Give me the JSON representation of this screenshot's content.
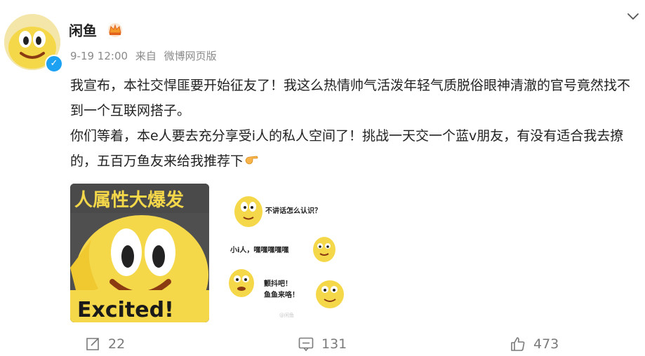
{
  "user": {
    "name": "闲鱼",
    "time": "9-19 12:00",
    "source_prefix": "来自",
    "source": "微博网页版",
    "badge_icon": "crown-icon",
    "verified_icon": "verified-badge-icon"
  },
  "post": {
    "paragraph1": "我宣布，本社交悍匪要开始征友了！我这么热情帅气活泼年轻气质脱俗眼神清澈的官号竟然找不到一个互联网搭子。",
    "paragraph2": "你们等着，本e人要去充分享受i人的私人空间了！挑战一天交一个蓝v朋友，有没有适合我去撩的，五百万鱼友来给我推荐下",
    "emoji": "pointing-hand-emoji"
  },
  "images": {
    "img1": {
      "top_text": "人属性大爆发",
      "bottom_text": "Excited!"
    },
    "img2": {
      "q1": "不讲话怎么认识？",
      "q2": "小i人，嘿嘿嘿嘿嘿",
      "q3a": "颤抖吧！",
      "q3b": "鱼鱼来咯！",
      "watermark": "@闲鱼"
    }
  },
  "actions": {
    "repost": "22",
    "comment": "131",
    "like": "473"
  },
  "colors": {
    "accent_blue": "#1da1f2",
    "icon_gray": "#7a7a7a",
    "mascot_yellow": "#f5d84a"
  }
}
